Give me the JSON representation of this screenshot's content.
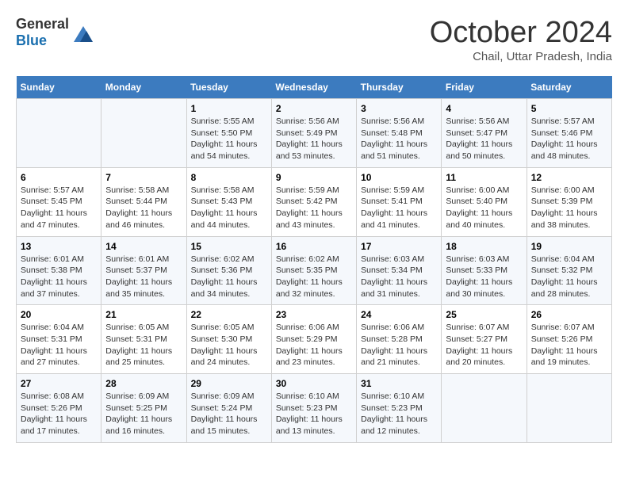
{
  "header": {
    "logo_general": "General",
    "logo_blue": "Blue",
    "title": "October 2024",
    "location": "Chail, Uttar Pradesh, India"
  },
  "weekdays": [
    "Sunday",
    "Monday",
    "Tuesday",
    "Wednesday",
    "Thursday",
    "Friday",
    "Saturday"
  ],
  "weeks": [
    [
      {
        "day": "",
        "sunrise": "",
        "sunset": "",
        "daylight": ""
      },
      {
        "day": "",
        "sunrise": "",
        "sunset": "",
        "daylight": ""
      },
      {
        "day": "1",
        "sunrise": "Sunrise: 5:55 AM",
        "sunset": "Sunset: 5:50 PM",
        "daylight": "Daylight: 11 hours and 54 minutes."
      },
      {
        "day": "2",
        "sunrise": "Sunrise: 5:56 AM",
        "sunset": "Sunset: 5:49 PM",
        "daylight": "Daylight: 11 hours and 53 minutes."
      },
      {
        "day": "3",
        "sunrise": "Sunrise: 5:56 AM",
        "sunset": "Sunset: 5:48 PM",
        "daylight": "Daylight: 11 hours and 51 minutes."
      },
      {
        "day": "4",
        "sunrise": "Sunrise: 5:56 AM",
        "sunset": "Sunset: 5:47 PM",
        "daylight": "Daylight: 11 hours and 50 minutes."
      },
      {
        "day": "5",
        "sunrise": "Sunrise: 5:57 AM",
        "sunset": "Sunset: 5:46 PM",
        "daylight": "Daylight: 11 hours and 48 minutes."
      }
    ],
    [
      {
        "day": "6",
        "sunrise": "Sunrise: 5:57 AM",
        "sunset": "Sunset: 5:45 PM",
        "daylight": "Daylight: 11 hours and 47 minutes."
      },
      {
        "day": "7",
        "sunrise": "Sunrise: 5:58 AM",
        "sunset": "Sunset: 5:44 PM",
        "daylight": "Daylight: 11 hours and 46 minutes."
      },
      {
        "day": "8",
        "sunrise": "Sunrise: 5:58 AM",
        "sunset": "Sunset: 5:43 PM",
        "daylight": "Daylight: 11 hours and 44 minutes."
      },
      {
        "day": "9",
        "sunrise": "Sunrise: 5:59 AM",
        "sunset": "Sunset: 5:42 PM",
        "daylight": "Daylight: 11 hours and 43 minutes."
      },
      {
        "day": "10",
        "sunrise": "Sunrise: 5:59 AM",
        "sunset": "Sunset: 5:41 PM",
        "daylight": "Daylight: 11 hours and 41 minutes."
      },
      {
        "day": "11",
        "sunrise": "Sunrise: 6:00 AM",
        "sunset": "Sunset: 5:40 PM",
        "daylight": "Daylight: 11 hours and 40 minutes."
      },
      {
        "day": "12",
        "sunrise": "Sunrise: 6:00 AM",
        "sunset": "Sunset: 5:39 PM",
        "daylight": "Daylight: 11 hours and 38 minutes."
      }
    ],
    [
      {
        "day": "13",
        "sunrise": "Sunrise: 6:01 AM",
        "sunset": "Sunset: 5:38 PM",
        "daylight": "Daylight: 11 hours and 37 minutes."
      },
      {
        "day": "14",
        "sunrise": "Sunrise: 6:01 AM",
        "sunset": "Sunset: 5:37 PM",
        "daylight": "Daylight: 11 hours and 35 minutes."
      },
      {
        "day": "15",
        "sunrise": "Sunrise: 6:02 AM",
        "sunset": "Sunset: 5:36 PM",
        "daylight": "Daylight: 11 hours and 34 minutes."
      },
      {
        "day": "16",
        "sunrise": "Sunrise: 6:02 AM",
        "sunset": "Sunset: 5:35 PM",
        "daylight": "Daylight: 11 hours and 32 minutes."
      },
      {
        "day": "17",
        "sunrise": "Sunrise: 6:03 AM",
        "sunset": "Sunset: 5:34 PM",
        "daylight": "Daylight: 11 hours and 31 minutes."
      },
      {
        "day": "18",
        "sunrise": "Sunrise: 6:03 AM",
        "sunset": "Sunset: 5:33 PM",
        "daylight": "Daylight: 11 hours and 30 minutes."
      },
      {
        "day": "19",
        "sunrise": "Sunrise: 6:04 AM",
        "sunset": "Sunset: 5:32 PM",
        "daylight": "Daylight: 11 hours and 28 minutes."
      }
    ],
    [
      {
        "day": "20",
        "sunrise": "Sunrise: 6:04 AM",
        "sunset": "Sunset: 5:31 PM",
        "daylight": "Daylight: 11 hours and 27 minutes."
      },
      {
        "day": "21",
        "sunrise": "Sunrise: 6:05 AM",
        "sunset": "Sunset: 5:31 PM",
        "daylight": "Daylight: 11 hours and 25 minutes."
      },
      {
        "day": "22",
        "sunrise": "Sunrise: 6:05 AM",
        "sunset": "Sunset: 5:30 PM",
        "daylight": "Daylight: 11 hours and 24 minutes."
      },
      {
        "day": "23",
        "sunrise": "Sunrise: 6:06 AM",
        "sunset": "Sunset: 5:29 PM",
        "daylight": "Daylight: 11 hours and 23 minutes."
      },
      {
        "day": "24",
        "sunrise": "Sunrise: 6:06 AM",
        "sunset": "Sunset: 5:28 PM",
        "daylight": "Daylight: 11 hours and 21 minutes."
      },
      {
        "day": "25",
        "sunrise": "Sunrise: 6:07 AM",
        "sunset": "Sunset: 5:27 PM",
        "daylight": "Daylight: 11 hours and 20 minutes."
      },
      {
        "day": "26",
        "sunrise": "Sunrise: 6:07 AM",
        "sunset": "Sunset: 5:26 PM",
        "daylight": "Daylight: 11 hours and 19 minutes."
      }
    ],
    [
      {
        "day": "27",
        "sunrise": "Sunrise: 6:08 AM",
        "sunset": "Sunset: 5:26 PM",
        "daylight": "Daylight: 11 hours and 17 minutes."
      },
      {
        "day": "28",
        "sunrise": "Sunrise: 6:09 AM",
        "sunset": "Sunset: 5:25 PM",
        "daylight": "Daylight: 11 hours and 16 minutes."
      },
      {
        "day": "29",
        "sunrise": "Sunrise: 6:09 AM",
        "sunset": "Sunset: 5:24 PM",
        "daylight": "Daylight: 11 hours and 15 minutes."
      },
      {
        "day": "30",
        "sunrise": "Sunrise: 6:10 AM",
        "sunset": "Sunset: 5:23 PM",
        "daylight": "Daylight: 11 hours and 13 minutes."
      },
      {
        "day": "31",
        "sunrise": "Sunrise: 6:10 AM",
        "sunset": "Sunset: 5:23 PM",
        "daylight": "Daylight: 11 hours and 12 minutes."
      },
      {
        "day": "",
        "sunrise": "",
        "sunset": "",
        "daylight": ""
      },
      {
        "day": "",
        "sunrise": "",
        "sunset": "",
        "daylight": ""
      }
    ]
  ]
}
